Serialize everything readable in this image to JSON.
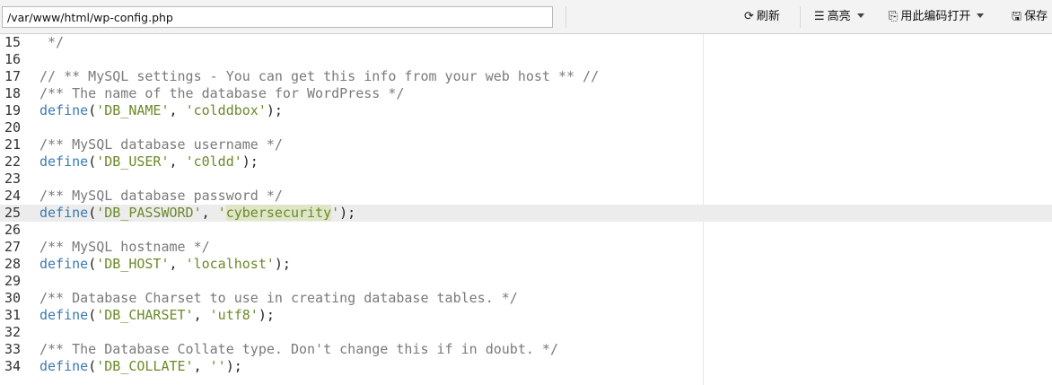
{
  "toolbar": {
    "path": "/var/www/html/wp-config.php",
    "refresh_label": "刷新",
    "highlight_label": "高亮",
    "open_with_encoding_label": "用此编码打开",
    "save_label": "保存"
  },
  "editor": {
    "lines": [
      {
        "num": "15",
        "t": "comment",
        "comment": " */"
      },
      {
        "num": "16",
        "t": "blank"
      },
      {
        "num": "17",
        "t": "comment",
        "comment": "// ** MySQL settings - You can get this info from your web host ** //"
      },
      {
        "num": "18",
        "t": "comment",
        "comment": "/** The name of the database for WordPress */"
      },
      {
        "num": "19",
        "t": "define",
        "func": "define",
        "key": "'DB_NAME'",
        "sep": ", ",
        "val": "'colddbox'",
        "end": ");"
      },
      {
        "num": "20",
        "t": "blank"
      },
      {
        "num": "21",
        "t": "comment",
        "comment": "/** MySQL database username */"
      },
      {
        "num": "22",
        "t": "define",
        "func": "define",
        "key": "'DB_USER'",
        "sep": ", ",
        "val": "'c0ldd'",
        "end": ");"
      },
      {
        "num": "23",
        "t": "blank"
      },
      {
        "num": "24",
        "t": "comment",
        "comment": "/** MySQL database password */"
      },
      {
        "num": "25",
        "t": "define",
        "func": "define",
        "key": "'DB_PASSWORD'",
        "sep": ", ",
        "valq1": "'",
        "valhl": "cybersecurity",
        "valq2": "'",
        "end": ");",
        "active": true
      },
      {
        "num": "26",
        "t": "blank"
      },
      {
        "num": "27",
        "t": "comment",
        "comment": "/** MySQL hostname */"
      },
      {
        "num": "28",
        "t": "define",
        "func": "define",
        "key": "'DB_HOST'",
        "sep": ", ",
        "val": "'localhost'",
        "end": ");"
      },
      {
        "num": "29",
        "t": "blank"
      },
      {
        "num": "30",
        "t": "comment",
        "comment": "/** Database Charset to use in creating database tables. */"
      },
      {
        "num": "31",
        "t": "define",
        "func": "define",
        "key": "'DB_CHARSET'",
        "sep": ", ",
        "val": "'utf8'",
        "end": ");"
      },
      {
        "num": "32",
        "t": "blank"
      },
      {
        "num": "33",
        "t": "comment",
        "comment": "/** The Database Collate type. Don't change this if in doubt. */"
      },
      {
        "num": "34",
        "t": "define",
        "func": "define",
        "key": "'DB_COLLATE'",
        "sep": ", ",
        "val": "''",
        "end": ");"
      }
    ]
  },
  "colors": {
    "comment": "#7a7a7a",
    "function": "#3a7ab0",
    "string": "#6b8a2a",
    "active_line": "#ececec",
    "word_highlight": "#dfe6c8"
  }
}
